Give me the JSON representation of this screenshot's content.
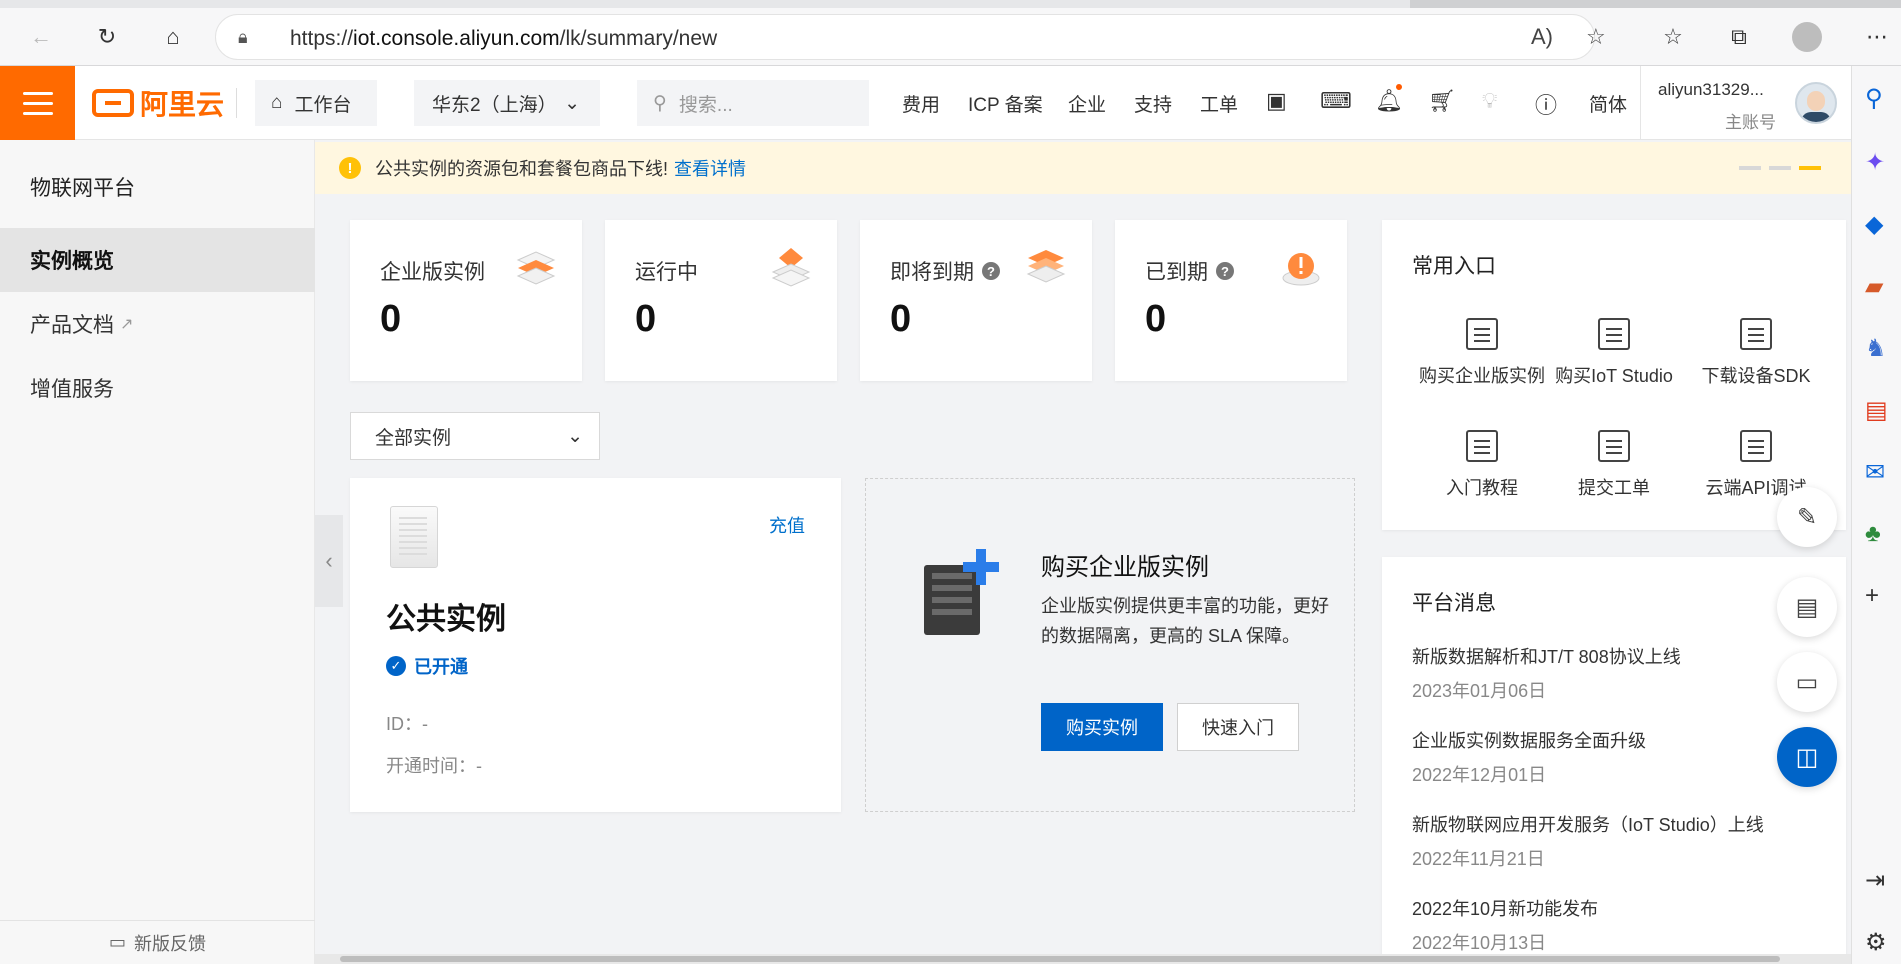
{
  "browser": {
    "url_prefix": "https://",
    "url_host": "iot.console.aliyun.com",
    "url_path": "/lk/summary/new"
  },
  "header": {
    "logo_text": "阿里云",
    "workbench": "工作台",
    "region": "华东2（上海）",
    "search_placeholder": "搜索...",
    "nav": [
      "费用",
      "ICP 备案",
      "企业",
      "支持",
      "工单"
    ],
    "lang": "简体",
    "user_name": "aliyun31329...",
    "user_role": "主账号"
  },
  "sidebar": {
    "title": "物联网平台",
    "items": [
      {
        "label": "实例概览",
        "active": true
      },
      {
        "label": "产品文档",
        "external": true
      },
      {
        "label": "增值服务"
      }
    ],
    "feedback": "新版反馈"
  },
  "notice": {
    "text": "公共实例的资源包和套餐包商品下线!",
    "link": "查看详情"
  },
  "stats": [
    {
      "label": "企业版实例",
      "value": "0",
      "help": false
    },
    {
      "label": "运行中",
      "value": "0",
      "help": false
    },
    {
      "label": "即将到期",
      "value": "0",
      "help": true
    },
    {
      "label": "已到期",
      "value": "0",
      "help": true
    }
  ],
  "filter": {
    "selected": "全部实例"
  },
  "public_instance": {
    "recharge": "充值",
    "name": "公共实例",
    "status": "已开通",
    "id_label": "ID：-",
    "open_time": "开通时间：-"
  },
  "buy_card": {
    "title": "购买企业版实例",
    "desc": "企业版实例提供更丰富的功能，更好的数据隔离，更高的 SLA 保障。",
    "primary": "购买实例",
    "secondary": "快速入门"
  },
  "quick": {
    "title": "常用入口",
    "items": [
      "购买企业版实例",
      "购买IoT Studio",
      "下载设备SDK",
      "入门教程",
      "提交工单",
      "云端API调试"
    ]
  },
  "messages": {
    "title": "平台消息",
    "items": [
      {
        "title": "新版数据解析和JT/T 808协议上线",
        "date": "2023年01月06日"
      },
      {
        "title": "企业版实例数据服务全面升级",
        "date": "2022年12月01日"
      },
      {
        "title": "新版物联网应用开发服务（IoT Studio）上线",
        "date": "2022年11月21日"
      },
      {
        "title": "2022年10月新功能发布",
        "date": "2022年10月13日"
      }
    ]
  },
  "colors": {
    "brand": "#ff6a00",
    "primary": "#0064c8",
    "link": "#0070cc",
    "notice_bg": "#fff7e0"
  }
}
